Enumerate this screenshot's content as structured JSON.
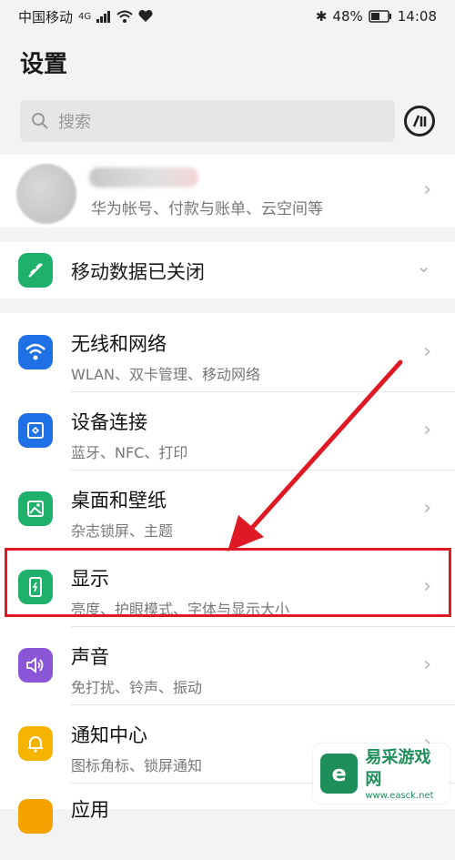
{
  "status_bar": {
    "carrier": "中国移动",
    "network": "4G",
    "battery": "48%",
    "time": "14:08"
  },
  "header": {
    "title": "设置"
  },
  "search": {
    "placeholder": "搜索"
  },
  "account": {
    "subtitle": "华为帐号、付款与账单、云空间等"
  },
  "mobile_data": {
    "label": "移动数据已关闭"
  },
  "settings": [
    {
      "title": "无线和网络",
      "subtitle": "WLAN、双卡管理、移动网络",
      "icon": "wifi-icon",
      "color": "#1f6fe5"
    },
    {
      "title": "设备连接",
      "subtitle": "蓝牙、NFC、打印",
      "icon": "device-connect-icon",
      "color": "#1f6fe5"
    },
    {
      "title": "桌面和壁纸",
      "subtitle": "杂志锁屏、主题",
      "icon": "wallpaper-icon",
      "color": "#1fb06b"
    },
    {
      "title": "显示",
      "subtitle": "亮度、护眼模式、字体与显示大小",
      "icon": "display-icon",
      "color": "#1fb06b"
    },
    {
      "title": "声音",
      "subtitle": "免打扰、铃声、振动",
      "icon": "sound-icon",
      "color": "#8a55d6"
    },
    {
      "title": "通知中心",
      "subtitle": "图标角标、锁屏通知",
      "icon": "notification-icon",
      "color": "#f5b400"
    },
    {
      "title": "应用",
      "subtitle": "",
      "icon": "apps-icon",
      "color": "#f5a300"
    }
  ],
  "watermark": {
    "name": "易采游戏网",
    "url": "www.easck.net"
  }
}
